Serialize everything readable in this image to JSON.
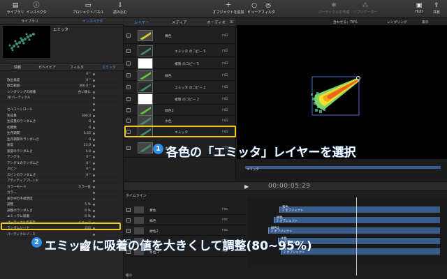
{
  "toolbar": {
    "library": "ライブラリ",
    "inspector": "インスペクタ",
    "project_panel": "プロジェクトパネル",
    "import": "読み込む",
    "add_object": "オブジェクトを追加",
    "preview": "ビューア",
    "filter": "フィルタ",
    "particle_emitter": "パーティクルを作成",
    "replicator": "リプリケーター",
    "hud": "HUD",
    "share": "共有"
  },
  "left_tabs": {
    "library": "ライブラリ",
    "inspector": "インスペクタ"
  },
  "preview_title": "エミッタ",
  "inspector_tabs": {
    "info": "情報",
    "behavior": "ビヘイビア",
    "filter": "フィルタ",
    "emitter": "エミッタ"
  },
  "properties": [
    {
      "label": "",
      "value": "0 °"
    },
    {
      "label": "放出角度",
      "value": "0 °"
    },
    {
      "label": "放出範囲",
      "value": "360.0 °"
    },
    {
      "label": "レンダリングの順番",
      "value": "古い順に"
    },
    {
      "label": "3Dパーティクル",
      "value": ""
    },
    {
      "label": "",
      "value": ""
    },
    {
      "label": "セルコントロール",
      "value": ""
    },
    {
      "label": "生成量",
      "value": "300.0"
    },
    {
      "label": "生成量のランダムさ",
      "value": "0"
    },
    {
      "label": "初期数",
      "value": "0"
    },
    {
      "label": "生存期間",
      "value": "5.55"
    },
    {
      "label": "生存期間のランダムさ",
      "value": "0"
    },
    {
      "label": "速度",
      "value": "23.0"
    },
    {
      "label": "速度のランダムさ",
      "value": "5.0"
    },
    {
      "label": "アングル",
      "value": "0 °"
    },
    {
      "label": "アングルのランダムさ",
      "value": "0 °"
    },
    {
      "label": "スピン",
      "value": "0 °"
    },
    {
      "label": "スピンのランダムさ",
      "value": "0 °"
    },
    {
      "label": "アディティブブレンド",
      "value": ""
    },
    {
      "label": "カラーモード",
      "value": "カラー在"
    },
    {
      "label": "カラー",
      "value": ""
    },
    {
      "label": "表示中の不透明度",
      "value": ""
    },
    {
      "label": "調整",
      "value": "5 %"
    },
    {
      "label": "調整のランダムさ",
      "value": "0 %"
    },
    {
      "label": "エミッタに吸着",
      "value": "0 %"
    },
    {
      "label": "パーティクルの表示",
      "value": "イメージ"
    },
    {
      "label": "ランダムシード",
      "value": "233"
    },
    {
      "label": "パーティクルソース",
      "value": ""
    }
  ],
  "layers_tabs": {
    "layers": "レイヤー",
    "media": "メディア",
    "audio": "オーディオ"
  },
  "layers": [
    {
      "name": "黄色",
      "kind": "group"
    },
    {
      "name": "エミッタ のコピー 5",
      "kind": "emitter"
    },
    {
      "name": "複製 のコピー 5",
      "kind": "copy"
    },
    {
      "name": "緑色",
      "kind": "group"
    },
    {
      "name": "エミッタ のコピー 2",
      "kind": "emitter"
    },
    {
      "name": "複製 のコピー 2",
      "kind": "copy"
    },
    {
      "name": "緑色2",
      "kind": "group"
    },
    {
      "name": "水色",
      "kind": "group"
    },
    {
      "name": "エミッタ",
      "kind": "emitter"
    },
    {
      "name": "水色 2",
      "kind": "group"
    }
  ],
  "viewer": {
    "fit": "合わせる：70%",
    "render": "レンダリング",
    "display": "表示"
  },
  "annotations": {
    "step1_num": "1",
    "step1_text": "各色の「エミッタ」レイヤーを選択",
    "step2_num": "2",
    "step2_text": "エミッタに吸着の値を大きくして調整(80~95%)"
  },
  "timeline": {
    "title": "タイムライン",
    "timecode": "00:00:05:29",
    "ruler_label": "エミッタ",
    "tracks": [
      "黄色",
      "緑色",
      "緑色2",
      "水色",
      "水色 2"
    ],
    "clips": [
      {
        "name": "黄色",
        "sub": "2 オブジェクト"
      },
      {
        "name": "緑色",
        "sub": "2 オブジェクト"
      },
      {
        "name": "緑色2",
        "sub": "2 オブジェクト"
      },
      {
        "name": "水色",
        "sub": "2 オブジェクト"
      },
      {
        "name": "水色2",
        "sub": "2 オブジェクト"
      }
    ],
    "zoom": "縮小"
  },
  "colors": {
    "accent": "#2c8ce6",
    "highlight": "#f0c81e",
    "clip": "#3a5c8a"
  }
}
